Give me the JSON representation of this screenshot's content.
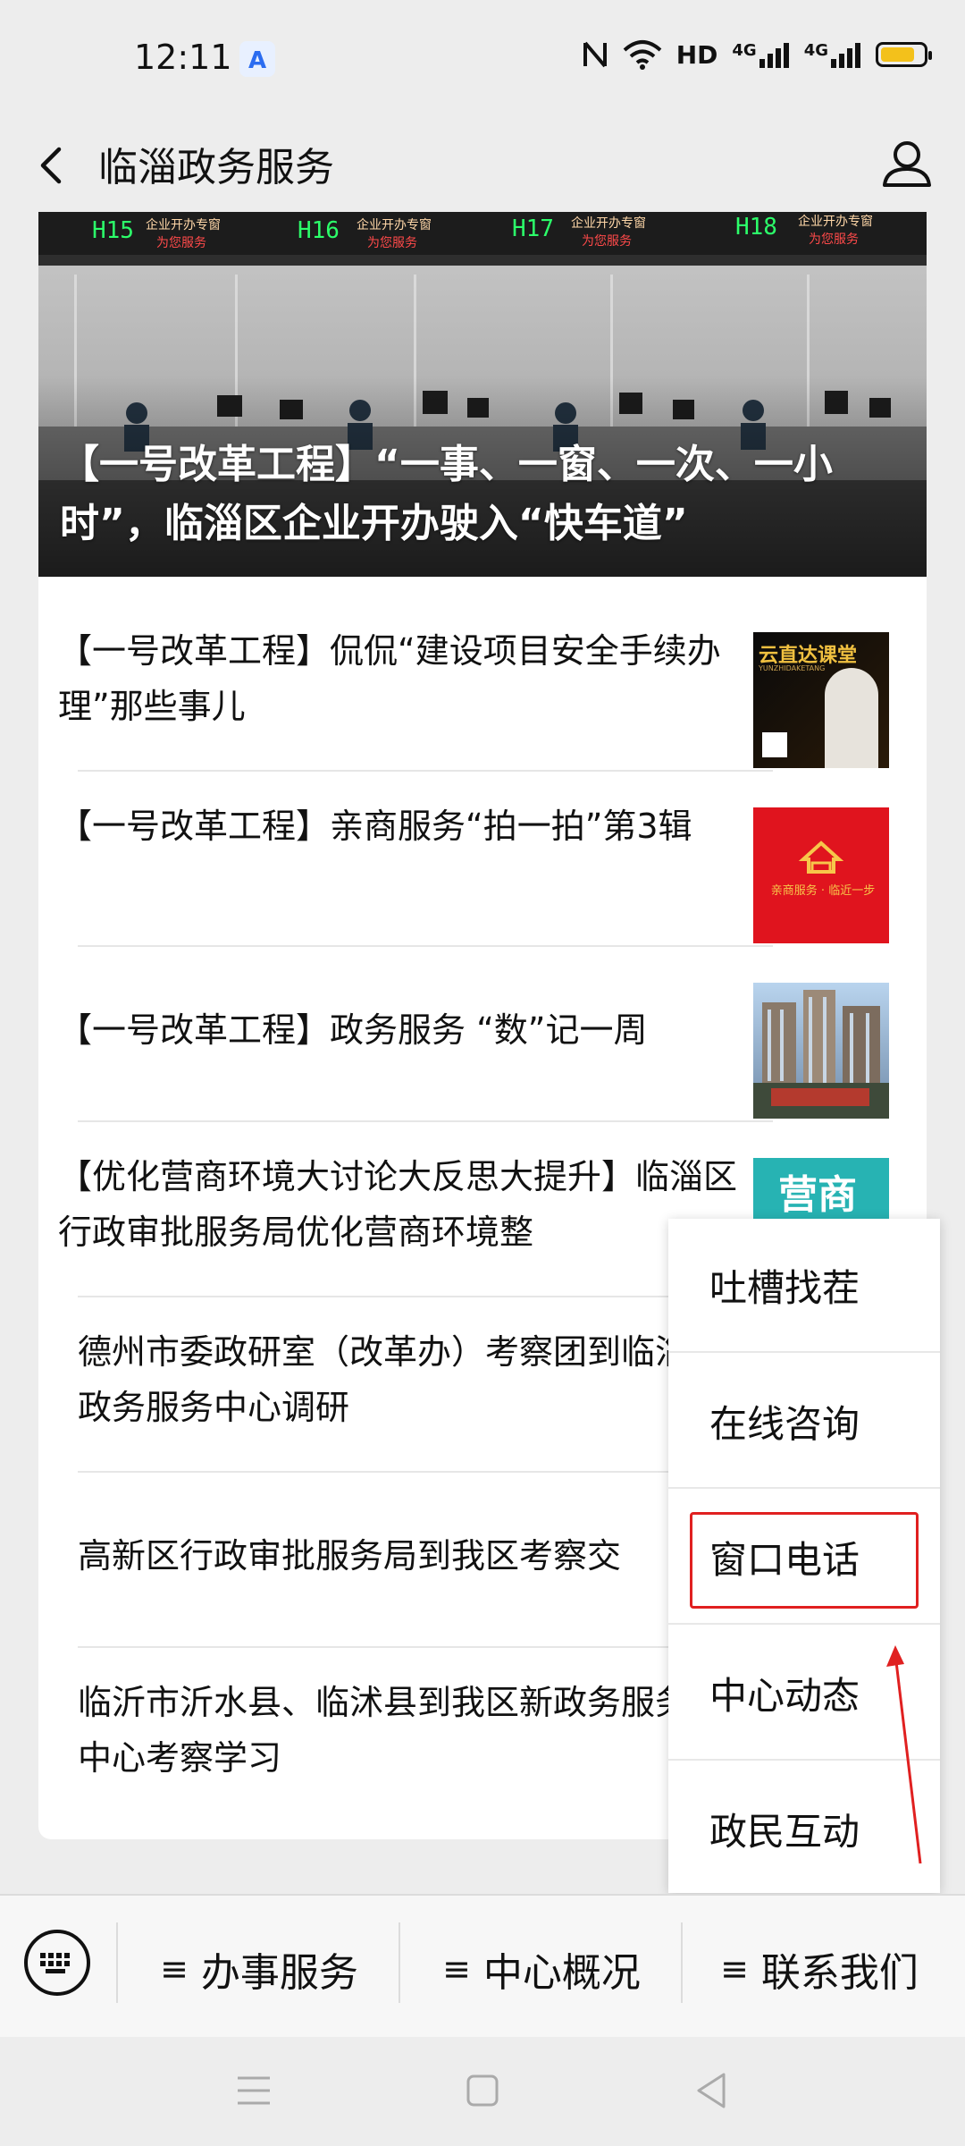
{
  "status_bar": {
    "time": "12:11",
    "app_badge": "A",
    "network_1": "HD",
    "network_2": "4G",
    "network_3": "4G",
    "battery_level": 0.8,
    "battery_color": "#f3c11b"
  },
  "nav": {
    "title": "临淄政务服务",
    "back_icon": "chevron-left-icon",
    "profile_icon": "user-icon"
  },
  "hero": {
    "caption": "【一号改革工程】“一事、一窗、一次、一小时”，临淄区企业开办驶入“快车道”",
    "window_labels": [
      "H15",
      "H16",
      "H17",
      "H18"
    ],
    "window_subtitles": [
      "企业开办专窗",
      "企业开办专窗",
      "企业开办专窗",
      "企业开办专窗"
    ],
    "window_notes": [
      "为您服务",
      "为您服务",
      "为您服务",
      "为您服务"
    ]
  },
  "articles": [
    {
      "title": "【一号改革工程】侃侃“建设项目安全手续办理”那些事儿",
      "thumb_text": "云直达课堂",
      "thumb_sub": "YUNZHIDAKETANG"
    },
    {
      "title": "【一号改革工程】亲商服务“拍一拍”第3辑",
      "thumb_text": "亲商服务 · 临近一步"
    },
    {
      "title": "【一号改革工程】政务服务 “数”记一周"
    },
    {
      "title": "【优化营商环境大讨论大反思大提升】临淄区行政审批服务局优化营商环境整",
      "thumb_text": "营商环境"
    },
    {
      "title": "德州市委政研室（改革办）考察团到临淄政务服务中心调研"
    },
    {
      "title": "高新区行政审批服务局到我区考察交"
    },
    {
      "title": "临沂市沂水县、临沭县到我区新政务服务中心考察学习"
    }
  ],
  "popup_menu": {
    "items": [
      "吐槽找茬",
      "在线咨询",
      "窗口电话",
      "中心动态",
      "政民互动"
    ],
    "highlighted": "窗口电话",
    "highlight_color": "#e02020"
  },
  "bottom_menu": {
    "keyboard_icon": "keyboard-icon",
    "tabs": [
      {
        "label": "办事服务",
        "icon": "menu-lines-icon"
      },
      {
        "label": "中心概况",
        "icon": "menu-lines-icon"
      },
      {
        "label": "联系我们",
        "icon": "menu-lines-icon"
      }
    ],
    "lines_glyph": "≡"
  },
  "system_nav": {
    "icons": [
      "menu-icon",
      "home-icon",
      "back-triangle-icon"
    ]
  }
}
